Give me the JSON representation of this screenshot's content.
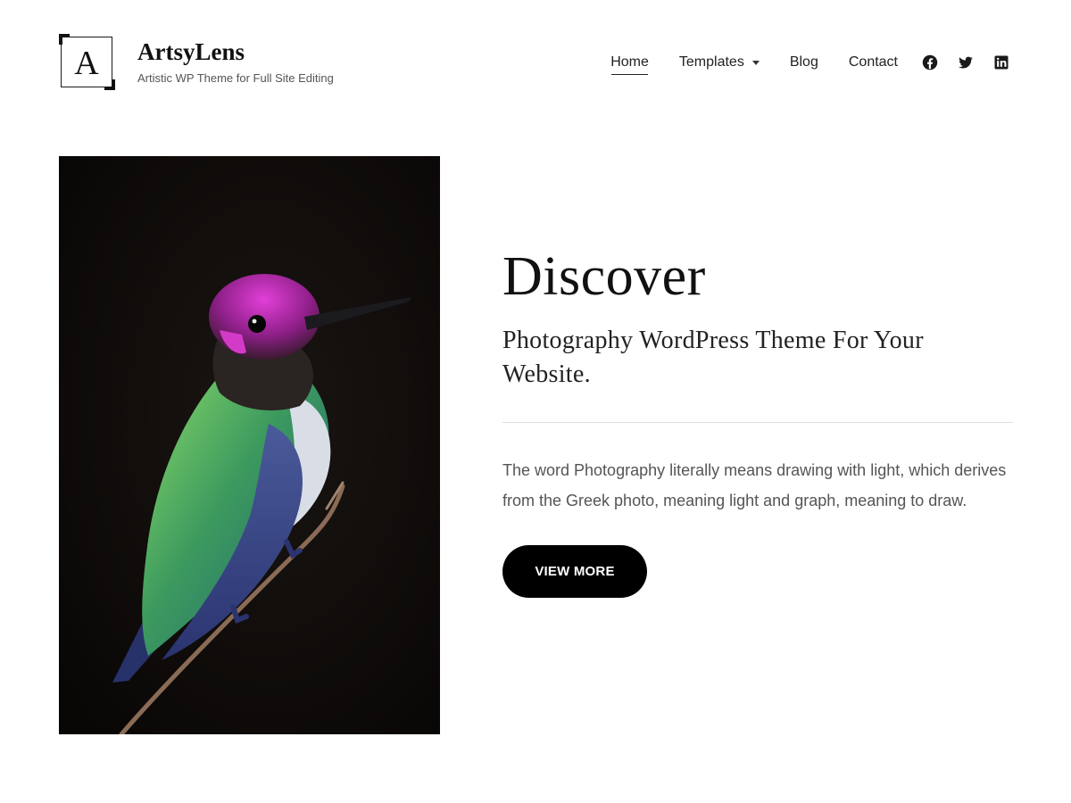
{
  "site": {
    "logo_letter": "A",
    "title": "ArtsyLens",
    "tagline": "Artistic WP Theme for Full Site Editing"
  },
  "nav": {
    "items": [
      {
        "label": "Home",
        "current": true
      },
      {
        "label": "Templates",
        "has_submenu": true
      },
      {
        "label": "Blog"
      },
      {
        "label": "Contact"
      }
    ],
    "social": [
      {
        "icon": "facebook-icon"
      },
      {
        "icon": "twitter-icon"
      },
      {
        "icon": "linkedin-icon"
      }
    ]
  },
  "hero": {
    "image": {
      "subject": "hummingbird-photo"
    },
    "heading": "Discover",
    "subheading": "Photography WordPress Theme For Your Website.",
    "body": "The word Photography literally means drawing with light, which derives from the Greek photo, meaning light and graph, meaning to draw.",
    "button_label": "VIEW MORE"
  },
  "colors": {
    "text": "#1a1a1a",
    "muted_text": "#555555",
    "button_bg": "#000000",
    "button_text": "#ffffff",
    "divider": "#dcdcdc",
    "photo_bg": "#0c0a09"
  }
}
